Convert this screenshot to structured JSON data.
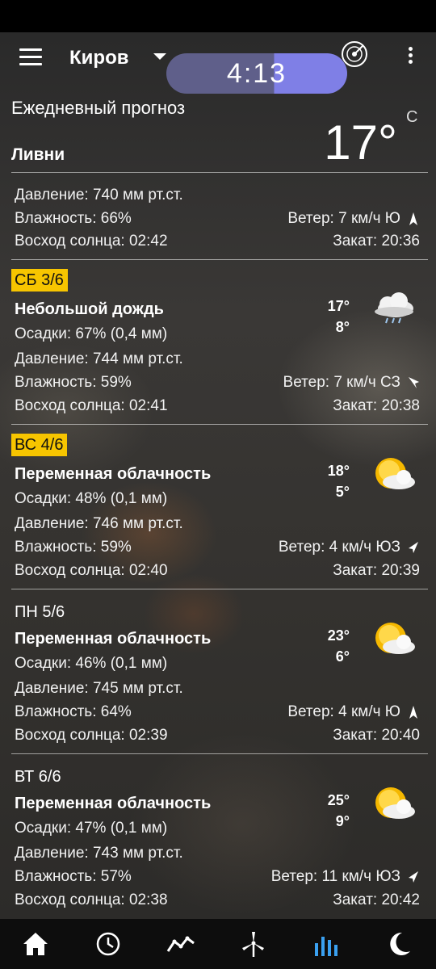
{
  "header": {
    "city": "Киров",
    "clock": "4:13"
  },
  "current": {
    "section_title": "Ежедневный прогноз",
    "temperature": "17°",
    "unit": "C",
    "condition": "Ливни",
    "pressure": "Давление: 740 мм рт.ст.",
    "humidity": "Влажность: 66%",
    "wind": "Ветер: 7 км/ч Ю",
    "sunrise": "Восход солнца: 02:42",
    "sunset": "Закат: 20:36"
  },
  "days": [
    {
      "label": "СБ 3/6",
      "condition": "Небольшой дождь",
      "high": "17°",
      "low": "8°",
      "precip": "Осадки: 67% (0,4 мм)",
      "pressure": "Давление: 744 мм рт.ст.",
      "humidity": "Влажность: 59%",
      "wind": "Ветер: 7 км/ч СЗ",
      "sunrise": "Восход солнца: 02:41",
      "sunset": "Закат: 20:38",
      "icon": "rain-cloud-icon",
      "wind_dir_icon": "wind-arrow-nw-icon",
      "highlight": true
    },
    {
      "label": "ВС 4/6",
      "condition": "Переменная облачность",
      "high": "18°",
      "low": "5°",
      "precip": "Осадки: 48% (0,1 мм)",
      "pressure": "Давление: 746 мм рт.ст.",
      "humidity": "Влажность: 59%",
      "wind": "Ветер: 4 км/ч ЮЗ",
      "sunrise": "Восход солнца: 02:40",
      "sunset": "Закат: 20:39",
      "icon": "partly-cloudy-icon",
      "wind_dir_icon": "wind-arrow-sw-icon",
      "highlight": true
    },
    {
      "label": "ПН 5/6",
      "condition": "Переменная облачность",
      "high": "23°",
      "low": "6°",
      "precip": "Осадки: 46% (0,1 мм)",
      "pressure": "Давление: 745 мм рт.ст.",
      "humidity": "Влажность: 64%",
      "wind": "Ветер: 4 км/ч Ю",
      "sunrise": "Восход солнца: 02:39",
      "sunset": "Закат: 20:40",
      "icon": "partly-cloudy-icon",
      "wind_dir_icon": "wind-arrow-s-icon",
      "highlight": false
    },
    {
      "label": "ВТ 6/6",
      "condition": "Переменная облачность",
      "high": "25°",
      "low": "9°",
      "precip": "Осадки: 47% (0,1 мм)",
      "pressure": "Давление: 743 мм рт.ст.",
      "humidity": "Влажность: 57%",
      "wind": "Ветер: 11 км/ч ЮЗ",
      "sunrise": "Восход солнца: 02:38",
      "sunset": "Закат: 20:42",
      "icon": "partly-cloudy-icon",
      "wind_dir_icon": "wind-arrow-sw-icon",
      "highlight": false
    }
  ],
  "nav": {
    "items": [
      "home-icon",
      "clock-icon",
      "chart-icon",
      "wind-turbine-icon",
      "bars-icon",
      "moon-icon"
    ],
    "active": "bars-icon",
    "active_color": "#3aa0f0"
  },
  "colors": {
    "highlight": "#f7c500",
    "clock_left": "#5f5f8a",
    "clock_right": "#7f7fe6"
  }
}
